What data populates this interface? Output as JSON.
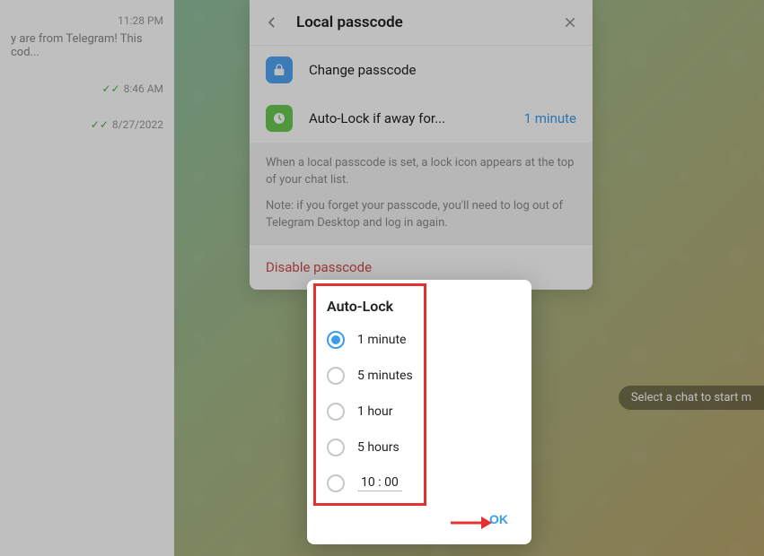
{
  "chat_list": {
    "items": [
      {
        "time": "11:28 PM",
        "preview": "y are from Telegram!  This cod..."
      },
      {
        "ticks": "✓✓",
        "time": "8:46 AM"
      },
      {
        "ticks": "✓✓",
        "time": "8/27/2022"
      }
    ]
  },
  "main": {
    "select_chat_hint": "Select a chat to start m"
  },
  "settings": {
    "title": "Local passcode",
    "rows": {
      "change": {
        "label": "Change passcode"
      },
      "autolock": {
        "label": "Auto-Lock if away for...",
        "value": "1 minute"
      }
    },
    "info1": "When a local passcode is set, a lock icon appears at the top of your chat list.",
    "info2": "Note: if you forget your passcode, you'll need to log out of Telegram Desktop and log in again.",
    "disable": "Disable passcode"
  },
  "dialog": {
    "title": "Auto-Lock",
    "options": [
      {
        "label": "1 minute",
        "checked": true
      },
      {
        "label": "5 minutes",
        "checked": false
      },
      {
        "label": "1 hour",
        "checked": false
      },
      {
        "label": "5 hours",
        "checked": false
      }
    ],
    "custom_time": "10 : 00",
    "ok": "OK"
  }
}
